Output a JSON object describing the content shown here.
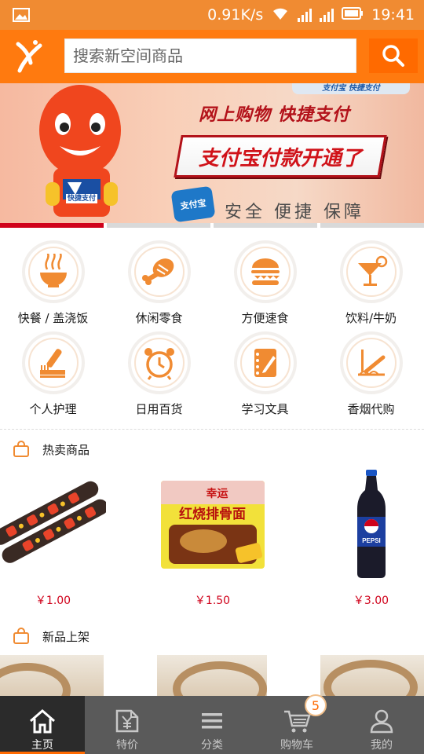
{
  "status_bar": {
    "speed": "0.91K/s",
    "time": "19:41"
  },
  "header": {
    "search_placeholder": "搜索新空间商品"
  },
  "banner": {
    "top_badge": "支付宝 快捷支付",
    "line1": "网上购物  快捷支付",
    "line2": "支付宝付款开通了",
    "line3": "安全 便捷 保障",
    "alipay_badge": "支付宝",
    "mascot_badge": "快捷支付"
  },
  "categories": [
    {
      "label": "快餐 / 盖浇饭",
      "icon": "noodle-bowl-icon"
    },
    {
      "label": "休闲零食",
      "icon": "meat-leg-icon"
    },
    {
      "label": "方便速食",
      "icon": "burger-icon"
    },
    {
      "label": "饮料/牛奶",
      "icon": "cocktail-icon"
    },
    {
      "label": "个人护理",
      "icon": "toothbrush-icon"
    },
    {
      "label": "日用百货",
      "icon": "alarm-clock-icon"
    },
    {
      "label": "学习文具",
      "icon": "notebook-pen-icon"
    },
    {
      "label": "香烟代购",
      "icon": "cigarette-icon"
    }
  ],
  "sections": {
    "hot": {
      "title": "热卖商品"
    },
    "new": {
      "title": "新品上架"
    }
  },
  "hot_products": [
    {
      "price": "￥1.00"
    },
    {
      "price": "￥1.50"
    },
    {
      "price": "￥3.00"
    }
  ],
  "product_art": {
    "noodle_brand": "幸运",
    "noodle_name": "红烧排骨面",
    "cola_brand": "PEPSI"
  },
  "tabs": [
    {
      "label": "主页",
      "icon": "home-icon",
      "active": true
    },
    {
      "label": "特价",
      "icon": "price-tag-icon"
    },
    {
      "label": "分类",
      "icon": "menu-icon"
    },
    {
      "label": "购物车",
      "icon": "cart-icon"
    },
    {
      "label": "我的",
      "icon": "user-icon"
    }
  ],
  "cart_count": "5",
  "colors": {
    "brand_orange": "#ff7a0f",
    "price_red": "#d0021b",
    "tabbar_gray": "#5a5a5a"
  }
}
